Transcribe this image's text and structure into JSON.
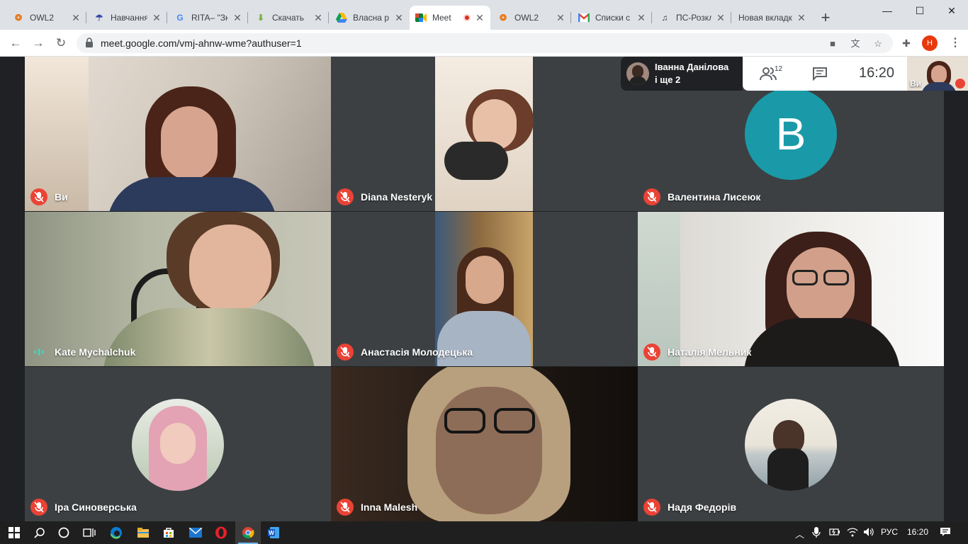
{
  "browser": {
    "tabs": [
      {
        "title": "OWL2",
        "icon": "owl-icon",
        "active": false
      },
      {
        "title": "Навчання",
        "icon": "umbrella-icon",
        "active": false
      },
      {
        "title": "RITA– \"Зн",
        "icon": "google-g-icon",
        "active": false
      },
      {
        "title": "Скачать",
        "icon": "download-arrow-icon",
        "active": false
      },
      {
        "title": "Власна р",
        "icon": "google-drive-icon",
        "active": false
      },
      {
        "title": "Meet",
        "icon": "google-meet-icon",
        "active": true
      },
      {
        "title": "OWL2",
        "icon": "owl-icon",
        "active": false
      },
      {
        "title": "Списки с",
        "icon": "gmail-icon",
        "active": false
      },
      {
        "title": "ПС-Розкл",
        "icon": "guitar-icon",
        "active": false
      },
      {
        "title": "Новая вкладк",
        "icon": "none",
        "active": false
      }
    ],
    "new_tab_label": "+",
    "window_controls": {
      "minimize": "—",
      "maximize": "☐",
      "close": "✕"
    },
    "address": {
      "url": "meet.google.com/vmj-ahnw-wme?authuser=1"
    },
    "profile_initial": "H"
  },
  "meet": {
    "presenter_info": {
      "line1": "Іванна Данілова",
      "line2": "і ще 2"
    },
    "participant_count": "12",
    "clock": "16:20",
    "self_label": "Ви",
    "tiles": [
      {
        "name": "Ви",
        "muted": true,
        "kind": "video-woman-red-hair"
      },
      {
        "name": "Diana Nesteryk",
        "muted": true,
        "kind": "video-narrow-bright"
      },
      {
        "name": "Валентина Лисеюк",
        "muted": true,
        "kind": "avatar-letter",
        "letter": "B",
        "color": "#1a9aa8"
      },
      {
        "name": "Kate Mychalchuk",
        "muted": false,
        "speaking": true,
        "kind": "video-girl-wallpaper"
      },
      {
        "name": "Анастасія Молодецька",
        "muted": true,
        "kind": "video-narrow-bookshelf"
      },
      {
        "name": "Наталія Мельник",
        "muted": true,
        "kind": "video-girl-glasses"
      },
      {
        "name": "Іра Синоверська",
        "muted": true,
        "kind": "avatar-photo-pink"
      },
      {
        "name": "Inna Malesh",
        "muted": true,
        "kind": "video-blonde-glasses"
      },
      {
        "name": "Надя Федорів",
        "muted": true,
        "kind": "avatar-photo-water"
      }
    ]
  },
  "taskbar": {
    "language": "РУС",
    "time": "16:20"
  },
  "colors": {
    "accent": "#1a73e8",
    "mute_red": "#ea4335",
    "tile_bg": "#3c4043",
    "meet_bg": "#202124"
  }
}
